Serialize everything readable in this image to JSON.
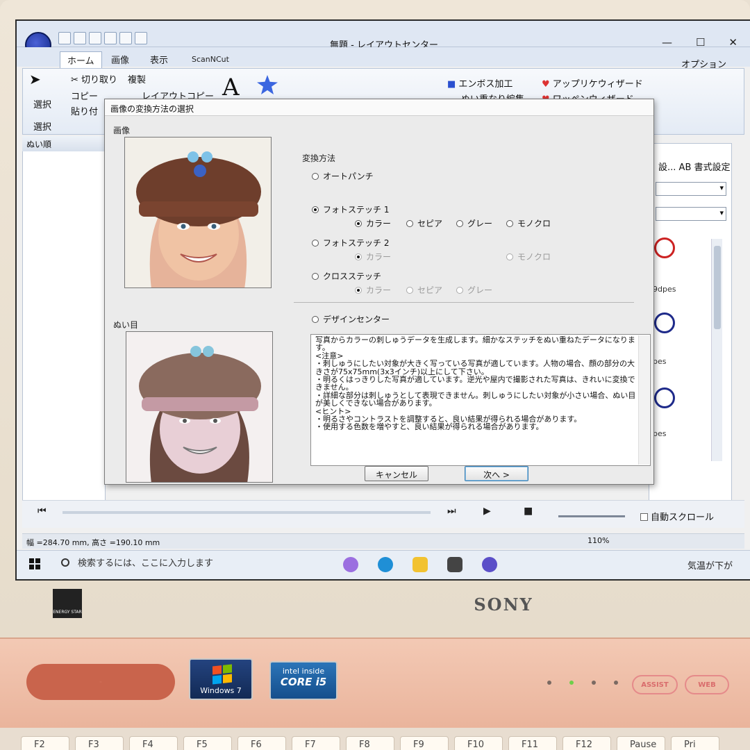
{
  "app": {
    "title": "無題 - レイアウトセンター",
    "options_label": "オプション",
    "tabs": [
      "ホーム",
      "画像",
      "表示",
      "ScanNCut"
    ],
    "window_controls": [
      "—",
      "☐",
      "✕"
    ]
  },
  "ribbon": {
    "select_label": "選択",
    "select_group": "選択",
    "cut_label": "切り取り",
    "copy_label": "複製",
    "copy2_label": "コピー",
    "layout_copy_label": "レイアウトコピー",
    "paste_label": "貼り付",
    "emboss_label": "エンボス加工",
    "sew_order_label": "ぬい重なり編集",
    "applique_label": "アップリケウィザード",
    "patch_label": "ワッペンウィザード"
  },
  "left_pane": {
    "title": "ぬい順"
  },
  "right_pane": {
    "format_label": "AB 書式設定",
    "truncated_label": "設...",
    "files": [
      "9dpes",
      "pes",
      "pes"
    ]
  },
  "transport": {
    "auto_scroll_label": "自動スクロール"
  },
  "status": {
    "dimensions": "幅 =284.70 mm, 高さ =190.10 mm",
    "zoom": "110%"
  },
  "taskbar": {
    "search_placeholder": "検索するには、ここに入力します",
    "weather": "気温が下が"
  },
  "dialog": {
    "title": "画像の変換方法の選択",
    "image_label": "画像",
    "stitch_label": "ぬい目",
    "method_label": "変換方法",
    "options": {
      "auto_punch": "オートパンチ",
      "photo_stitch_1": "フォトステッチ 1",
      "photo_stitch_2": "フォトステッチ 2",
      "cross_stitch": "クロスステッチ",
      "design_center": "デザインセンター"
    },
    "sub": {
      "color": "カラー",
      "sepia": "セピア",
      "gray": "グレー",
      "mono": "モノクロ"
    },
    "description": [
      "写真からカラーの刺しゅうデータを生成します。細かなステッチをぬい重ねたデータになります。",
      "<注意>",
      "・刺しゅうにしたい対象が大きく写っている写真が適しています。人物の場合、顔の部分の大きさが75x75mm(3x3インチ)以上にして下さい。",
      "・明るくはっきりした写真が適しています。逆光や屋内で撮影された写真は、きれいに変換できません。",
      "・詳細な部分は刺しゅうとして表現できません。刺しゅうにしたい対象が小さい場合、ぬい目が美しくできない場合があります。",
      "<ヒント>",
      "・明るさやコントラストを調整すると、良い結果が得られる場合があります。",
      "・使用する色数を増やすと、良い結果が得られる場合があります。"
    ],
    "cancel_label": "キャンセル",
    "next_label": "次へ >"
  },
  "hardware": {
    "brand": "SONY",
    "energy_star": "ENERGY STAR",
    "windows_badge": "Windows 7",
    "intel_top": "intel inside",
    "intel_bottom": "CORE i5",
    "assist_label": "ASSIST",
    "web_label": "WEB",
    "function_keys": [
      "F2",
      "F3",
      "F4",
      "F5",
      "F6",
      "F7",
      "F8",
      "F9",
      "F10",
      "F11",
      "F12",
      "Pause",
      "Pri"
    ]
  }
}
